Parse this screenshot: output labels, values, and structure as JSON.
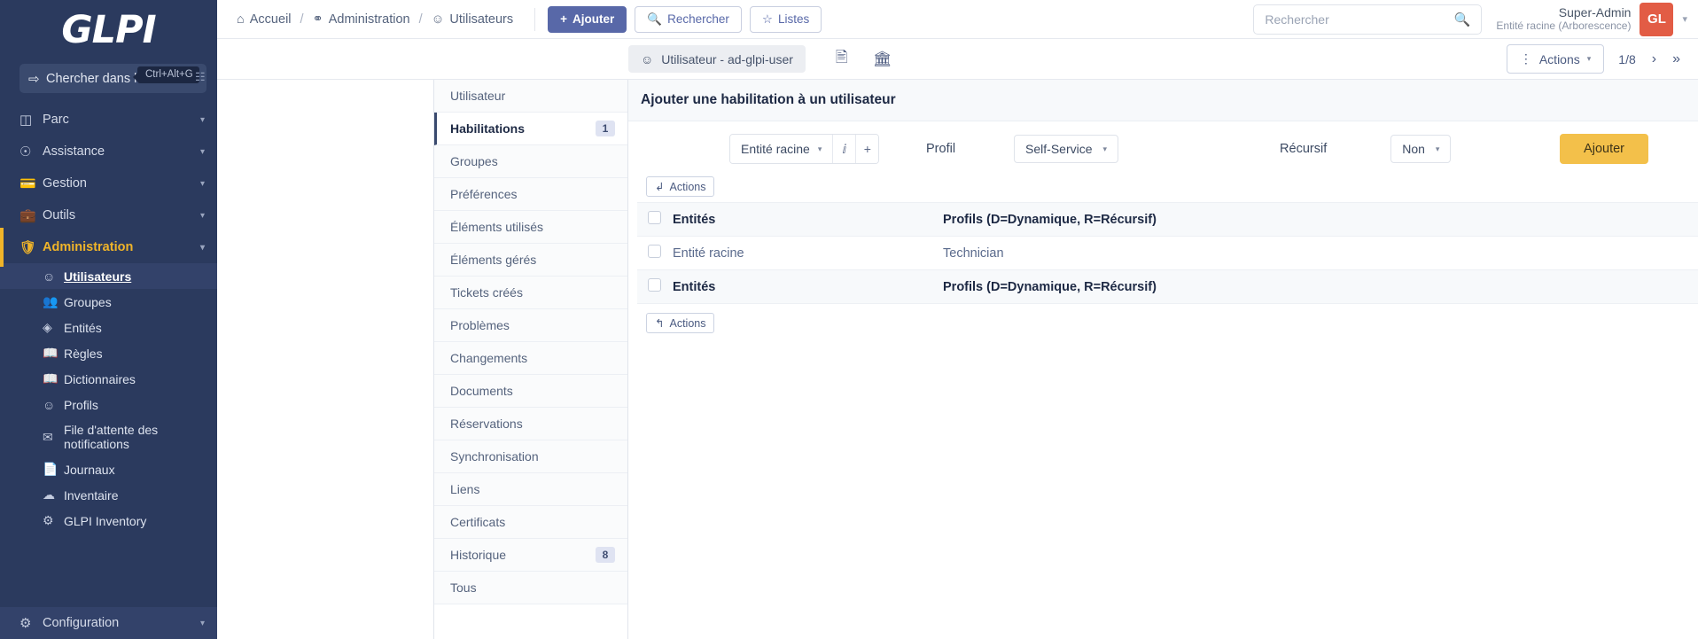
{
  "brand": {
    "logo_text": "GLPI"
  },
  "menu_search": {
    "label": "Chercher dans le menu",
    "icon": "arrow-right-icon",
    "shortcut": "Ctrl+Alt+G"
  },
  "sidebar": {
    "items": [
      {
        "label": "Parc",
        "icon": "box-icon",
        "expandable": true
      },
      {
        "label": "Assistance",
        "icon": "headset-icon",
        "expandable": true
      },
      {
        "label": "Gestion",
        "icon": "wallet-icon",
        "expandable": true
      },
      {
        "label": "Outils",
        "icon": "briefcase-icon",
        "expandable": true
      },
      {
        "label": "Administration",
        "icon": "shield-icon",
        "expandable": true,
        "active": true
      }
    ],
    "admin_children": [
      {
        "label": "Utilisateurs",
        "icon": "user-icon",
        "selected": true
      },
      {
        "label": "Groupes",
        "icon": "users-icon"
      },
      {
        "label": "Entités",
        "icon": "layers-icon"
      },
      {
        "label": "Règles",
        "icon": "book-icon"
      },
      {
        "label": "Dictionnaires",
        "icon": "book-icon"
      },
      {
        "label": "Profils",
        "icon": "user-check-icon"
      },
      {
        "label": "File d'attente des notifications",
        "icon": "notification-icon"
      },
      {
        "label": "Journaux",
        "icon": "journal-icon"
      },
      {
        "label": "Inventaire",
        "icon": "cloud-download-icon"
      },
      {
        "label": "GLPI Inventory",
        "icon": "gear-icon"
      }
    ],
    "footer": {
      "label": "Configuration",
      "icon": "gear-icon",
      "expandable": true
    }
  },
  "topbar": {
    "breadcrumb": [
      {
        "label": "Accueil",
        "icon": "home-icon"
      },
      {
        "label": "Administration",
        "icon": "shield-icon"
      },
      {
        "label": "Utilisateurs",
        "icon": "user-icon"
      }
    ],
    "buttons": [
      {
        "label": "Ajouter",
        "icon": "plus-icon",
        "style": "primary"
      },
      {
        "label": "Rechercher",
        "icon": "search-icon",
        "style": "outline"
      },
      {
        "label": "Listes",
        "icon": "star-icon",
        "style": "outline"
      }
    ],
    "search": {
      "placeholder": "Rechercher",
      "value": "",
      "icon": "search-icon"
    },
    "user": {
      "name": "Super-Admin",
      "entity": "Entité racine (Arborescence)",
      "initials": "GL",
      "avatar_color": "#e25c45"
    }
  },
  "subbar": {
    "object_tab": {
      "label": "Utilisateur - ad-glpi-user",
      "icon": "user-icon"
    },
    "icons": [
      {
        "name": "vcard-icon"
      },
      {
        "name": "bank-icon"
      }
    ],
    "actions_button": {
      "label": "Actions",
      "icon": "dots-vertical-icon",
      "caret": "chevron-down-icon"
    },
    "pagination": {
      "position": "1/8",
      "next_icon": "chevron-right-icon",
      "last_icon": "chevrons-right-icon"
    }
  },
  "tabs": [
    {
      "label": "Utilisateur",
      "badge": ""
    },
    {
      "label": "Habilitations",
      "badge": "1",
      "active": true
    },
    {
      "label": "Groupes",
      "badge": ""
    },
    {
      "label": "Préférences",
      "badge": ""
    },
    {
      "label": "Éléments utilisés",
      "badge": ""
    },
    {
      "label": "Éléments gérés",
      "badge": ""
    },
    {
      "label": "Tickets créés",
      "badge": ""
    },
    {
      "label": "Problèmes",
      "badge": ""
    },
    {
      "label": "Changements",
      "badge": ""
    },
    {
      "label": "Documents",
      "badge": ""
    },
    {
      "label": "Réservations",
      "badge": ""
    },
    {
      "label": "Synchronisation",
      "badge": ""
    },
    {
      "label": "Liens",
      "badge": ""
    },
    {
      "label": "Certificats",
      "badge": ""
    },
    {
      "label": "Historique",
      "badge": "8"
    },
    {
      "label": "Tous",
      "badge": ""
    }
  ],
  "panel": {
    "title": "Ajouter une habilitation à un utilisateur",
    "form": {
      "entity_value": "Entité racine",
      "entity_info_icon": "info-icon",
      "entity_add_icon": "plus-icon",
      "profil_label": "Profil",
      "profil_value": "Self-Service",
      "recursif_label": "Récursif",
      "recursif_value": "Non",
      "submit_label": "Ajouter"
    },
    "table": {
      "actions_top_label": "Actions",
      "actions_bottom_label": "Actions",
      "actions_top_icon": "arrow-down-left-icon",
      "actions_bottom_icon": "arrow-up-left-icon",
      "headers": [
        "Entités",
        "Profils (D=Dynamique, R=Récursif)"
      ],
      "rows": [
        {
          "entity": "Entité racine",
          "profile": "Technician"
        }
      ],
      "footer_headers": [
        "Entités",
        "Profils (D=Dynamique, R=Récursif)"
      ]
    }
  }
}
